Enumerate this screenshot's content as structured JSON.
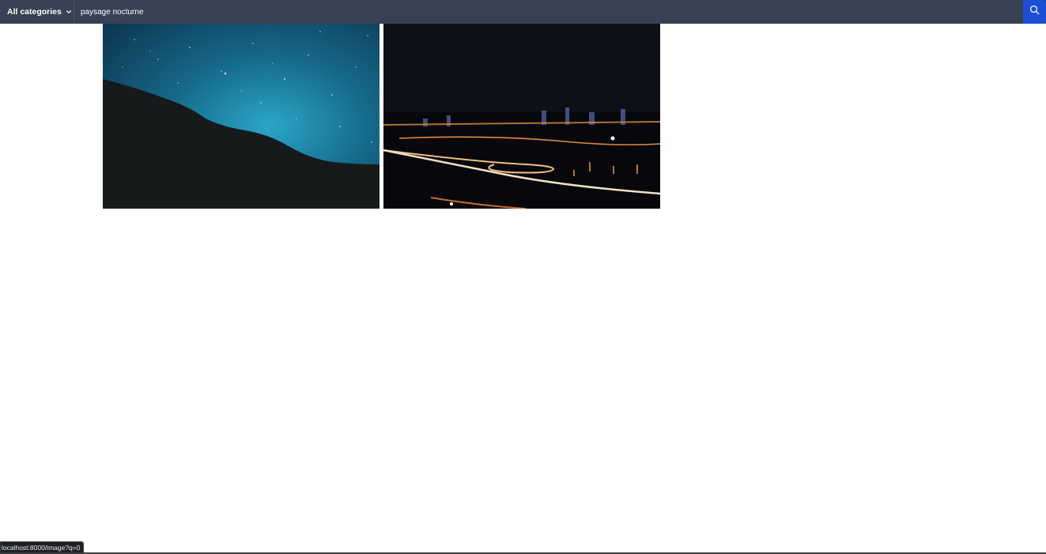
{
  "header": {
    "category_label": "All categories",
    "category_icon": "chevron-down-icon",
    "search_value": "paysage nocturne",
    "search_placeholder": "Search",
    "search_icon": "search-icon",
    "accent_color": "#1d4ed8",
    "bar_color": "#374151"
  },
  "results": [
    {
      "subject": "starry-sky-hillside"
    },
    {
      "subject": "city-night-highway"
    }
  ],
  "status_bar": {
    "url": "localhost:8000/image?q=0"
  }
}
